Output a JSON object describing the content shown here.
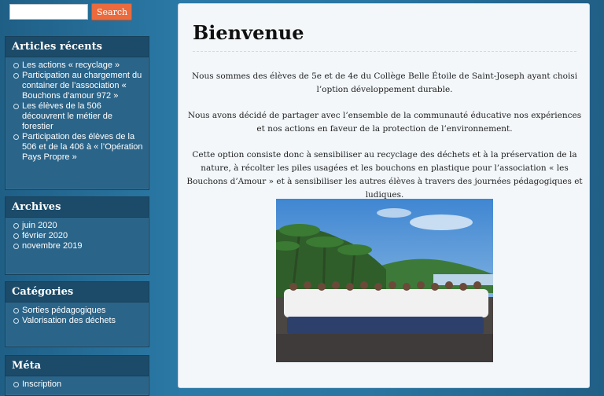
{
  "search": {
    "placeholder": "",
    "button_label": "Search"
  },
  "widgets": {
    "recent": {
      "title": "Articles récents",
      "items": [
        "Les actions « recyclage »",
        "Participation au chargement du container de l’association « Bouchons d’amour 972 »",
        "Les élèves de la 506 découvrent le métier de forestier",
        "Participation des élèves de la 506 et de la 406 à « l’Opération Pays Propre »"
      ]
    },
    "archives": {
      "title": "Archives",
      "items": [
        "juin 2020",
        "février 2020",
        "novembre 2019"
      ]
    },
    "categories": {
      "title": "Catégories",
      "items": [
        "Sorties pédagogiques",
        "Valorisation des déchets"
      ]
    },
    "meta": {
      "title": "Méta",
      "items": [
        "Inscription"
      ]
    }
  },
  "main": {
    "title": "Bienvenue",
    "paragraphs": [
      "Nous sommes des élèves de 5e et de 4e du Collège Belle Étoile de Saint-Joseph ayant choisi l’option développement durable.",
      "Nous avons décidé de partager avec l’ensemble de la communauté éducative nos expériences et nos actions en faveur de la protection de l’environnement.",
      "Cette option consiste donc à sensibiliser au recyclage des déchets et à la préservation de la nature,  à récolter les piles usagées et les bouchons en plastique pour l’association « les Bouchons d’Amour » et à sensibiliser les autres élèves à travers des journées pédagogiques et ludiques."
    ]
  },
  "colors": {
    "accent": "#ec6a3b",
    "widget_bg": "#2a6489",
    "widget_header": "#1b4b69",
    "page_bg": "#2b79a6"
  }
}
